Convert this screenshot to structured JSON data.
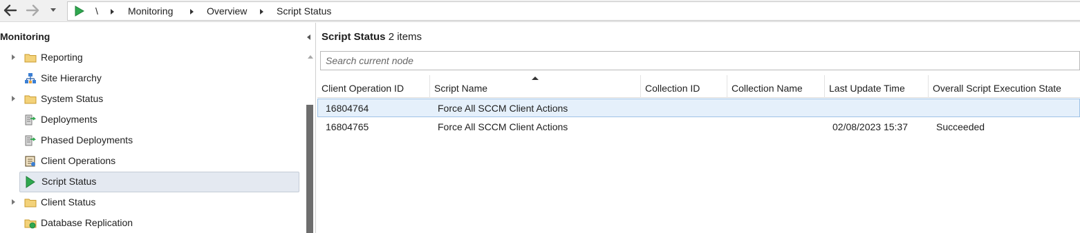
{
  "address_bar": {
    "breadcrumb": [
      "\\",
      "Monitoring",
      "Overview",
      "Script Status"
    ]
  },
  "nav_pane": {
    "title": "Monitoring",
    "items": [
      {
        "label": "Reporting",
        "icon": "folder-icon",
        "expandable": true
      },
      {
        "label": "Site Hierarchy",
        "icon": "site-hierarchy-icon",
        "expandable": false
      },
      {
        "label": "System Status",
        "icon": "folder-icon",
        "expandable": true
      },
      {
        "label": "Deployments",
        "icon": "deployments-icon",
        "expandable": false
      },
      {
        "label": "Phased Deployments",
        "icon": "phased-deployments-icon",
        "expandable": false
      },
      {
        "label": "Client Operations",
        "icon": "client-operations-icon",
        "expandable": false
      },
      {
        "label": "Script Status",
        "icon": "run-script-icon",
        "expandable": false,
        "selected": true
      },
      {
        "label": "Client Status",
        "icon": "folder-icon",
        "expandable": true
      },
      {
        "label": "Database Replication",
        "icon": "database-replication-icon",
        "expandable": false
      }
    ]
  },
  "content": {
    "title": "Script Status",
    "count": "2 items",
    "search_placeholder": "Search current node",
    "columns": [
      "Client Operation ID",
      "Script Name",
      "Collection ID",
      "Collection Name",
      "Last Update Time",
      "Overall Script Execution State"
    ],
    "rows": [
      {
        "client_operation_id": "16804764",
        "script_name": "Force All SCCM Client Actions",
        "collection_id": "",
        "collection_name": "",
        "last_update_time": "",
        "state": "",
        "selected": true
      },
      {
        "client_operation_id": "16804765",
        "script_name": "Force All SCCM Client Actions",
        "collection_id": "",
        "collection_name": "",
        "last_update_time": "02/08/2023 15:37",
        "state": "Succeeded",
        "selected": false
      }
    ]
  },
  "colors": {
    "run_green": "#2fa84f",
    "folder_yellow": "#e8c25a",
    "selection_bg": "#e5f0fb"
  }
}
